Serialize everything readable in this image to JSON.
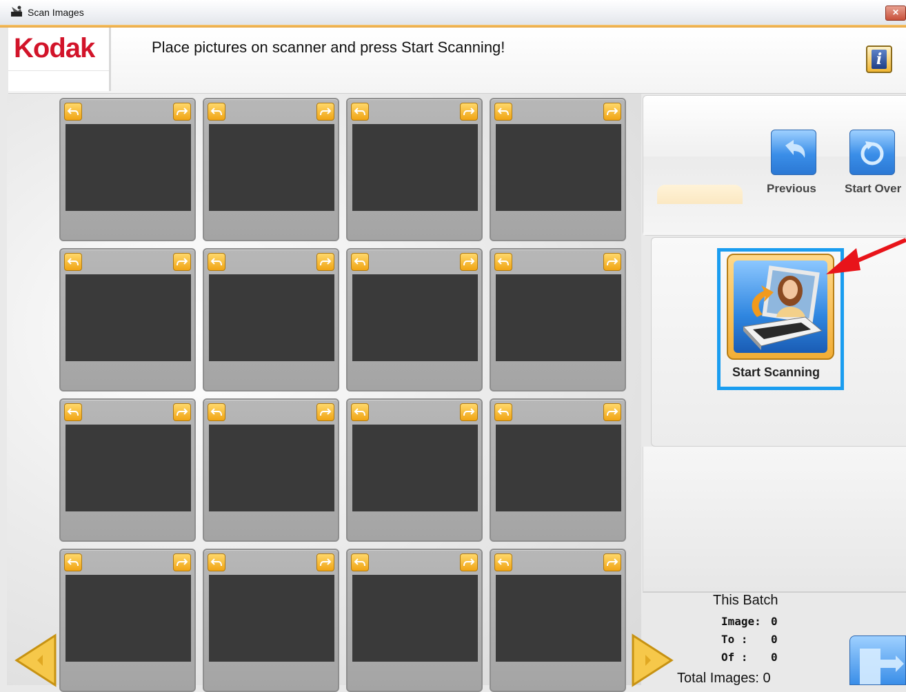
{
  "window": {
    "title": "Scan Images",
    "close_label": "✕"
  },
  "header": {
    "logo": "Kodak",
    "message": "Place pictures on scanner and press Start Scanning!",
    "info_label": "i"
  },
  "controls": {
    "previous_label": "Previous",
    "start_over_label": "Start Over",
    "start_scanning_label": "Start Scanning"
  },
  "stats": {
    "heading": "This Batch",
    "image_label": "Image:",
    "image_value": "0",
    "to_label": "To :",
    "to_value": "0",
    "of_label": "Of :",
    "of_value": "0",
    "total_label": "Total Images: 0"
  },
  "grid": {
    "rows": 4,
    "columns": 4,
    "tile_state": "empty"
  },
  "colors": {
    "accent_orange": "#f0a414",
    "accent_blue": "#3a8ee8",
    "highlight_blue": "#1a9df0",
    "arrow_red": "#e8141a",
    "brand_red": "#d2142a"
  }
}
